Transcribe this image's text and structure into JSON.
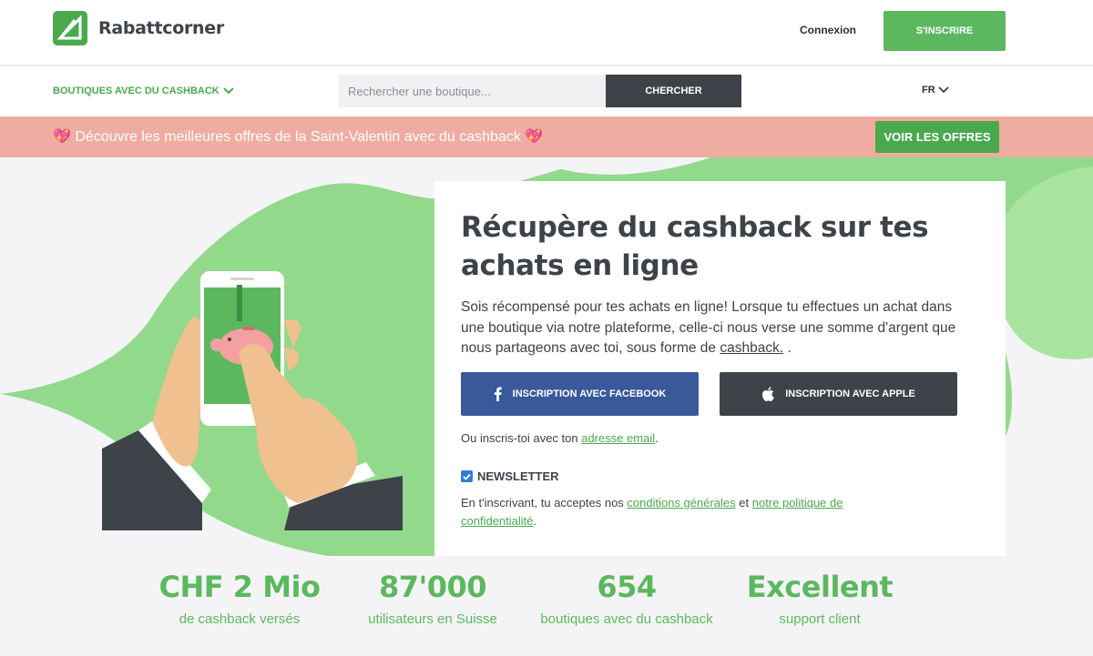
{
  "header": {
    "logo_text": "Rabattcorner",
    "login": "Connexion",
    "signup": "S'INSCRIRE"
  },
  "nav": {
    "shops_menu": "BOUTIQUES AVEC DU CASHBACK",
    "search_placeholder": "Rechercher une boutique...",
    "search_button": "CHERCHER",
    "language": "FR"
  },
  "promo": {
    "text": "💖 Découvre les meilleures offres de la Saint-Valentin avec du cashback 💖",
    "button": "VOIR LES OFFRES"
  },
  "hero": {
    "title": "Récupère du cashback sur tes achats en ligne",
    "description_pre": "Sois récompensé pour tes achats en ligne! Lorsque tu effectues un achat dans une boutique via notre plateforme, celle-ci nous verse une somme d'argent que nous partageons avec toi, sous forme de ",
    "description_link": "cashback.",
    "description_post": " .",
    "facebook_button": "INSCRIPTION AVEC FACEBOOK",
    "apple_button": "INSCRIPTION AVEC APPLE",
    "alt_pre": "Ou inscris-toi avec ton ",
    "alt_link": "adresse email",
    "alt_post": ".",
    "newsletter_label": "NEWSLETTER",
    "newsletter_checked": true,
    "terms_pre": "En t'inscrivant, tu acceptes nos ",
    "terms_link1": "conditions générales",
    "terms_mid": " et ",
    "terms_link2": "notre politique de confidentialité",
    "terms_post": "."
  },
  "stats": [
    {
      "value": "CHF 2 Mio",
      "label": "de cashback versés"
    },
    {
      "value": "87'000",
      "label": "utilisateurs en Suisse"
    },
    {
      "value": "654",
      "label": "boutiques avec du cashback"
    },
    {
      "value": "Excellent",
      "label": "support client"
    }
  ],
  "colors": {
    "brand_green": "#4aa84f",
    "promo_pink": "#eeada0",
    "facebook_blue": "#3a599b",
    "dark": "#3d4349"
  }
}
